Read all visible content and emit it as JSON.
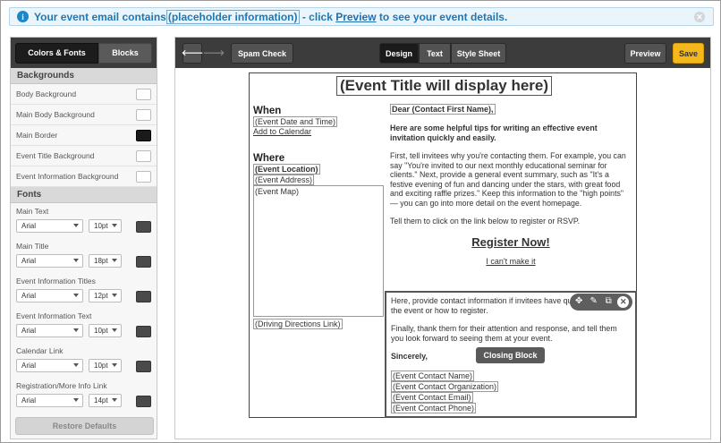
{
  "banner": {
    "prefix": "Your event email contains",
    "placeholder": "(placeholder information)",
    "middle": " - click ",
    "link": "Preview",
    "suffix": " to see your event details."
  },
  "left_panel": {
    "tabs": [
      "Colors & Fonts",
      "Blocks"
    ],
    "backgrounds_heading": "Backgrounds",
    "backgrounds": [
      {
        "label": "Body Background",
        "color": "#ffffff"
      },
      {
        "label": "Main Body Background",
        "color": "#ffffff"
      },
      {
        "label": "Main Border",
        "color": "#1a1a1a"
      },
      {
        "label": "Event Title Background",
        "color": "#ffffff"
      },
      {
        "label": "Event Information Background",
        "color": "#ffffff"
      }
    ],
    "fonts_heading": "Fonts",
    "fonts": [
      {
        "label": "Main Text",
        "font": "Arial",
        "size": "10pt",
        "color": "#4a4a4a"
      },
      {
        "label": "Main Title",
        "font": "Arial",
        "size": "18pt",
        "color": "#4a4a4a"
      },
      {
        "label": "Event Information Titles",
        "font": "Arial",
        "size": "12pt",
        "color": "#4a4a4a"
      },
      {
        "label": "Event Information Text",
        "font": "Arial",
        "size": "10pt",
        "color": "#4a4a4a"
      },
      {
        "label": "Calendar Link",
        "font": "Arial",
        "size": "10pt",
        "color": "#4a4a4a"
      },
      {
        "label": "Registration/More Info Link",
        "font": "Arial",
        "size": "14pt",
        "color": "#4a4a4a"
      }
    ],
    "restore_label": "Restore Defaults"
  },
  "toolbar": {
    "spam_check": "Spam Check",
    "design": "Design",
    "text": "Text",
    "style_sheet": "Style Sheet",
    "preview": "Preview",
    "save": "Save"
  },
  "email": {
    "title": "(Event Title will display here)",
    "when_heading": "When",
    "date_time": "(Event Date and Time)",
    "add_calendar": "Add to Calendar",
    "where_heading": "Where",
    "location": "(Event Location)",
    "address": "(Event Address)",
    "map": "(Event Map)",
    "directions": "(Driving Directions Link)",
    "greeting": "Dear (Contact First Name),",
    "intro": "Here are some helpful tips for writing an effective event invitation quickly and easily.",
    "body1": "First, tell invitees why you're contacting them. For example, you can say \"You're invited to our next monthly educational seminar for clients.\" Next, provide a general event summary, such as \"It's a festive evening of fun and dancing under the stars, with great food and exciting raffle prizes.\" Keep this information to the \"high points\" — you can go into more detail on the event homepage.",
    "body2": "Tell them to click on the link below to register or RSVP.",
    "register": "Register Now!",
    "cant_make": "I can't make it",
    "closing_p1": "Here, provide contact information if invitees have questions about the event or how to register.",
    "closing_p2": "Finally, thank them for their attention and response, and tell them you look forward to seeing them at your event.",
    "sincerely": "Sincerely,",
    "contact_name": "(Event Contact Name)",
    "contact_org": "(Event Contact Organization)",
    "contact_email": "(Event Contact Email)",
    "contact_phone": "(Event Contact Phone)",
    "closing_tag": "Closing Block"
  }
}
